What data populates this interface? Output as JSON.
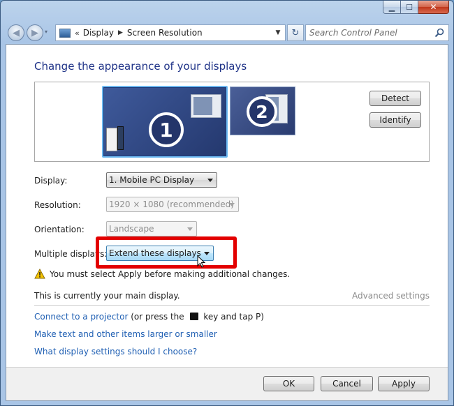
{
  "window": {
    "minimize": "▁",
    "maximize": "☐",
    "close": "✕"
  },
  "nav": {
    "back_glyph": "◀",
    "forward_glyph": "▶",
    "recent_dropdown": "▾",
    "address_prefix": "«",
    "breadcrumbs": [
      "Display",
      "Screen Resolution"
    ],
    "address_dropdown": "▼",
    "refresh_glyph": "↻",
    "search_placeholder": "Search Control Panel"
  },
  "main": {
    "title": "Change the appearance of your displays",
    "monitors": [
      {
        "number": "1",
        "selected": true
      },
      {
        "number": "2",
        "selected": false
      }
    ],
    "detect_label": "Detect",
    "identify_label": "Identify",
    "display_label": "Display:",
    "display_value": "1. Mobile PC Display",
    "resolution_label": "Resolution:",
    "resolution_value": "1920 × 1080 (recommended)",
    "orientation_label": "Orientation:",
    "orientation_value": "Landscape",
    "multiple_displays_label": "Multiple displays:",
    "multiple_displays_value": "Extend these displays",
    "warning_text": "You must select Apply before making additional changes.",
    "main_display_note": "This is currently your main display.",
    "advanced_settings": "Advanced settings",
    "projector_link": "Connect to a projector",
    "projector_suffix_a": "(or press the",
    "projector_suffix_b": "key and tap P)",
    "text_size_link": "Make text and other items larger or smaller",
    "help_link": "What display settings should I choose?"
  },
  "buttons": {
    "ok": "OK",
    "cancel": "Cancel",
    "apply": "Apply"
  },
  "colors": {
    "title": "#1e3287",
    "link": "#1f5fb3",
    "highlight": "#e30000",
    "monitor_selected_border": "#6cb8f0"
  }
}
